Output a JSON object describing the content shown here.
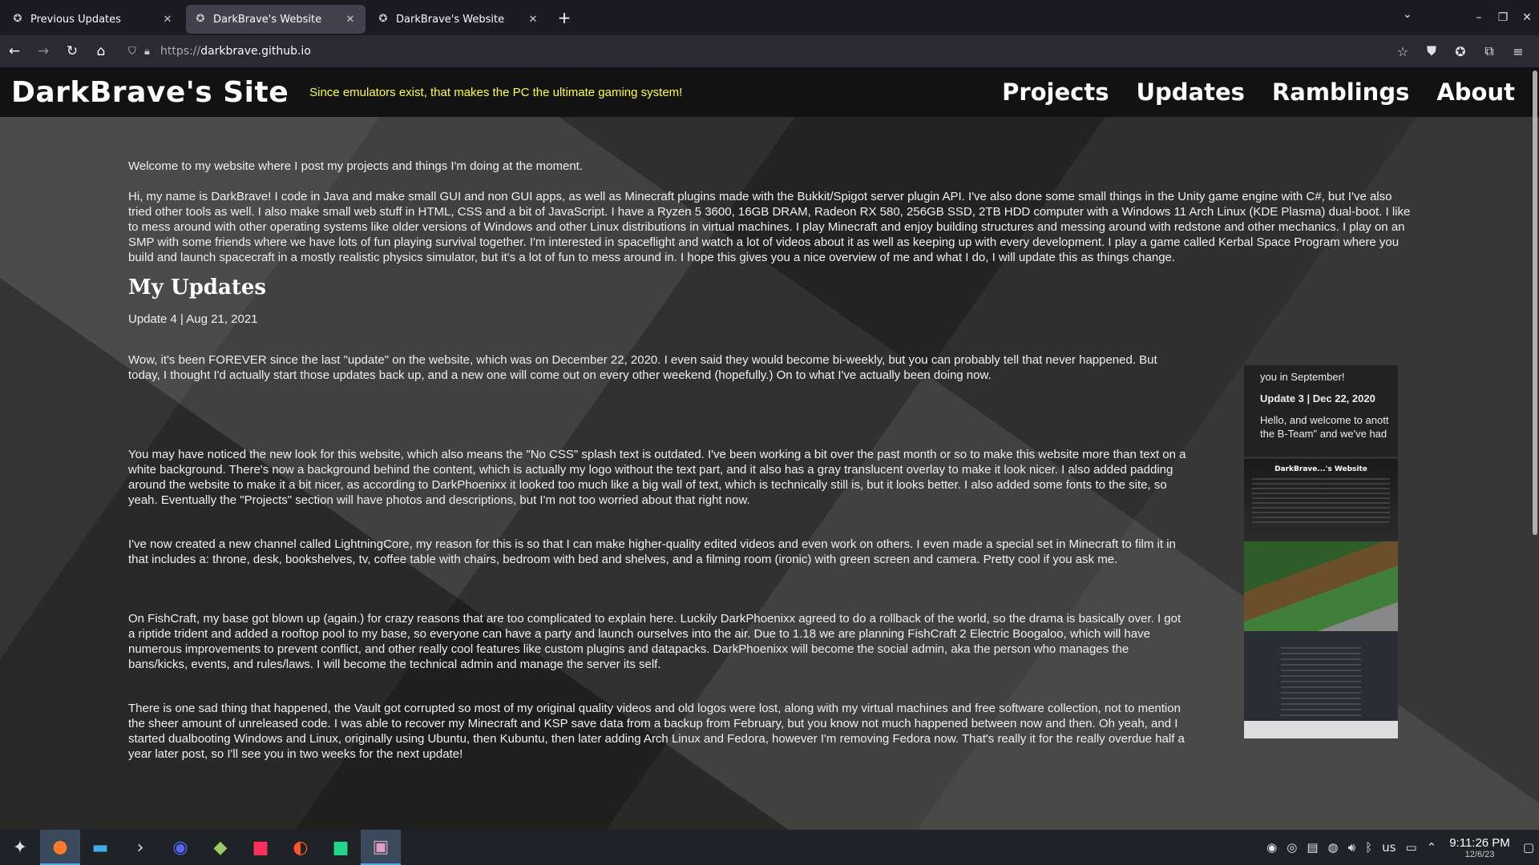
{
  "browser": {
    "tabs": [
      {
        "label": "Previous Updates",
        "active": false
      },
      {
        "label": "DarkBrave's Website",
        "active": true
      },
      {
        "label": "DarkBrave's Website",
        "active": false
      }
    ],
    "url_protocol": "https://",
    "url_host": "darkbrave.github.io"
  },
  "site": {
    "title": "DarkBrave's Site",
    "tagline": "Since emulators exist, that makes the PC the ultimate gaming system!",
    "nav": [
      "Projects",
      "Updates",
      "Ramblings",
      "About"
    ],
    "intro": "Welcome to my website where I post my projects and things I'm doing at the moment.",
    "bio": "Hi, my name is DarkBrave! I code in Java and make small GUI and non GUI apps, as well as Minecraft plugins made with the Bukkit/Spigot server plugin API. I've also done some small things in the Unity game engine with C#, but I've also tried other tools as well. I also make small web stuff in HTML, CSS and a bit of JavaScript. I have a Ryzen 5 3600, 16GB DRAM, Radeon RX 580, 256GB SSD, 2TB HDD computer with a Windows 11 Arch Linux (KDE Plasma) dual-boot. I like to mess around with other operating systems like older versions of Windows and other Linux distributions in virtual machines. I play Minecraft and enjoy building structures and messing around with redstone and other mechanics. I play on an SMP with some friends where we have lots of fun playing survival together. I'm interested in spaceflight and watch a lot of videos about it as well as keeping up with every development. I play a game called Kerbal Space Program where you build and launch spacecraft in a mostly realistic physics simulator, but it's a lot of fun to mess around in. I hope this gives you a nice overview of me and what I do, I will update this as things change.",
    "updates_heading": "My Updates",
    "update_title": "Update 4 | Aug 21, 2021",
    "update_paragraphs": [
      "Wow, it's been FOREVER since the last \"update\" on the website, which was on December 22, 2020. I even said they would become bi-weekly, but you can probably tell that never happened. But today, I thought I'd actually start those updates back up, and a new one will come out on every other weekend (hopefully.) On to what I've actually been doing now.",
      "You may have noticed the new look for this website, which also means the \"No CSS\" splash text is outdated. I've been working a bit over the past month or so to make this website more than text on a white background. There's now a background behind the content, which is actually my logo without the text part, and it also has a gray translucent overlay to make it look nicer. I also added padding around the website to make it a bit nicer, as according to DarkPhoenixx it looked too much like a big wall of text, which is technically still is, but it looks better. I also added some fonts to the site, so yeah. Eventually the \"Projects\" section will have photos and descriptions, but I'm not too worried about that right now.",
      "I've now created a new channel called LightningCore, my reason for this is so that I can make higher-quality edited videos and even work on others. I even made a special set in Minecraft to film it in that includes a: throne, desk, bookshelves, tv, coffee table with chairs, bedroom with bed and shelves, and a filming room (ironic) with green screen and camera. Pretty cool if you ask me.",
      "On FishCraft, my base got blown up (again.) for crazy reasons that are too complicated to explain here. Luckily DarkPhoenixx agreed to do a rollback of the world, so the drama is basically over. I got a riptide trident and added a rooftop pool to my base, so everyone can have a party and launch ourselves into the air. Due to 1.18 we are planning FishCraft 2 Electric Boogaloo, which will have numerous improvements to prevent conflict, and other really cool features like custom plugins and datapacks. DarkPhoenixx will become the social admin, aka the person who manages the bans/kicks, events, and rules/laws. I will become the technical admin and manage the server its self.",
      "There is one sad thing that happened, the Vault got corrupted so most of my original quality videos and old logos were lost, along with my virtual machines and free software collection, not to mention the sheer amount of unreleased code. I was able to recover my Minecraft and KSP save data from a backup from February, but you know not much happened between now and then. Oh yeah, and I started dualbooting Windows and Linux, originally using Ubuntu, then Kubuntu, then later adding Arch Linux and Fedora, however I'm removing Fedora now. That's really it for the really overdue half a year later post, so I'll see you in two weeks for the next update!"
    ],
    "side_frame": {
      "line1": "you in September!",
      "update3": "Update 3 | Dec 22, 2020",
      "line2": "Hello, and welcome to anott",
      "line3": "the B-Team\" and we've had",
      "thumb_title": "DarkBrave...'s Website"
    }
  },
  "taskbar": {
    "tray_lang": "us",
    "time": "9:11:26 PM",
    "date": "12/6/23"
  }
}
